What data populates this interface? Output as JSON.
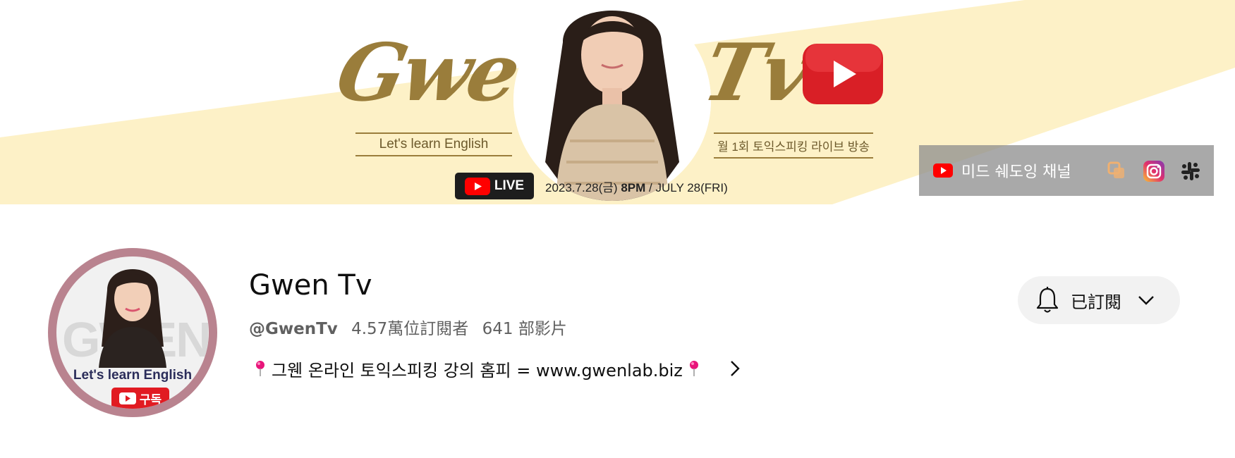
{
  "banner": {
    "title_left": "Gwen",
    "title_right": "Tv",
    "tagline": "Let's learn English",
    "schedule": "월 1회 토익스피킹 라이브 방송",
    "live_label": "LIVE",
    "date_text": "2023.7.28(금)",
    "time_text": "8PM",
    "date_en": "/ JULY 28(FRI)",
    "colors": {
      "stripe": "#fdf1c7",
      "gold": "#9a7d3b",
      "youtube_red": "#e11b22"
    }
  },
  "links": {
    "primary_label": "미드 쉐도잉 채널",
    "icons": [
      "youtube-icon",
      "link-icon",
      "instagram-icon",
      "slack-icon"
    ]
  },
  "avatar": {
    "watermark": "GWEN",
    "tagline": "Let's learn English",
    "subscribe_label": "구독"
  },
  "channel": {
    "name": "Gwen Tv",
    "handle": "@GwenTv",
    "subscribers": "4.57萬位訂閱者",
    "videos": "641 部影片",
    "description": "그웬 온라인 토익스피킹 강의 홈피 = www.gwenlab.biz"
  },
  "subscribe_button": {
    "label": "已訂閱"
  }
}
